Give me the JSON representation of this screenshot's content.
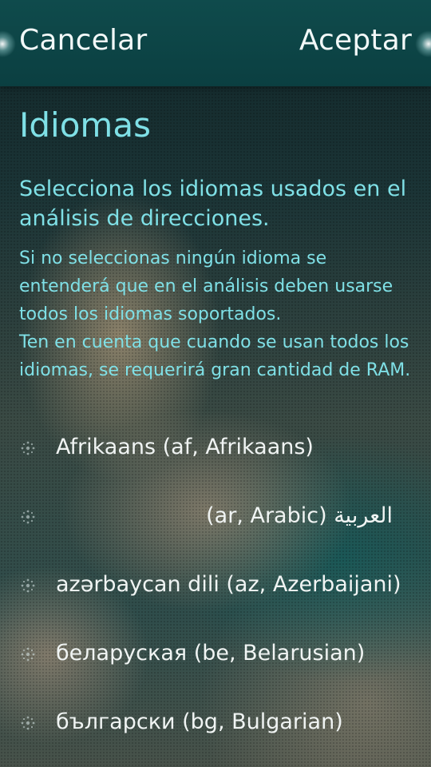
{
  "header": {
    "cancel_label": "Cancelar",
    "accept_label": "Aceptar"
  },
  "page": {
    "title": "Idiomas",
    "description": "Selecciona los idiomas usados en el análisis de direcciones.",
    "hint": "Si no seleccionas ningún idioma se entenderá que en el análisis deben usarse todos los idiomas soportados.\nTen en cuenta que cuando se usan todos los idiomas, se requerirá gran cantidad de RAM."
  },
  "languages": [
    {
      "label": "Afrikaans (af, Afrikaans)",
      "checked": false
    },
    {
      "label": "العربية (ar, Arabic)",
      "checked": false
    },
    {
      "label": "azərbaycan dili (az, Azerbaijani)",
      "checked": false
    },
    {
      "label": "беларуская (be, Belarusian)",
      "checked": false
    },
    {
      "label": "български (bg, Bulgarian)",
      "checked": false
    }
  ],
  "colors": {
    "accent": "#7fe0e6",
    "header_bg": "#0f4b4c",
    "primary_text": "#f0f4f3"
  }
}
